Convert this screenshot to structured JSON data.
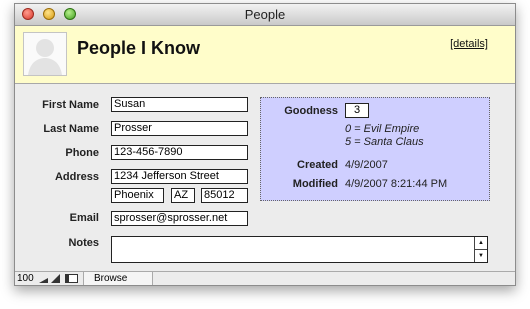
{
  "window": {
    "title": "People"
  },
  "header": {
    "title": "People I Know",
    "details_link": "[details]"
  },
  "person": {
    "labels": {
      "first_name": "First Name",
      "last_name": "Last Name",
      "phone": "Phone",
      "address": "Address",
      "email": "Email",
      "notes": "Notes"
    },
    "first_name": "Susan",
    "last_name": "Prosser",
    "phone": "123-456-7890",
    "street": "1234 Jefferson Street",
    "city": "Phoenix",
    "state": "AZ",
    "zip": "85012",
    "email": "sprosser@sprosser.net",
    "notes": ""
  },
  "goodness": {
    "label": "Goodness",
    "value": "3",
    "legend_low": "0 = Evil Empire",
    "legend_high": "5 = Santa Claus",
    "created_label": "Created",
    "created": "4/9/2007",
    "modified_label": "Modified",
    "modified": "4/9/2007 8:21:44 PM"
  },
  "statusbar": {
    "zoom": "100",
    "mode": "Browse"
  },
  "icons": [
    "close-icon",
    "minimize-icon",
    "zoom-icon",
    "person-silhouette-icon",
    "scroll-up-icon",
    "scroll-down-icon",
    "zoom-out-icon",
    "zoom-in-icon",
    "status-toggle-icon"
  ]
}
